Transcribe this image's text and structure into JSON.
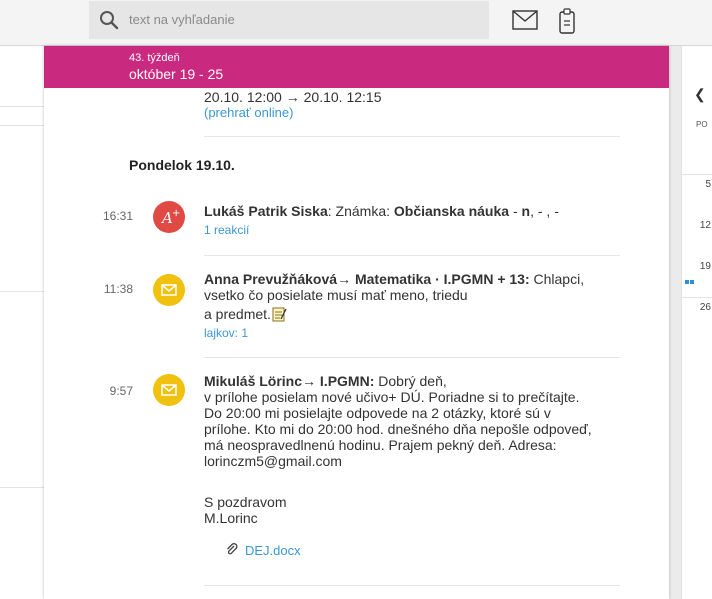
{
  "search": {
    "placeholder": "text na vyhľadanie"
  },
  "week": {
    "number_label": "43. týždeň",
    "range": "október 19 - 25"
  },
  "top_item": {
    "time_range": "20.10. 12:00 → 20.10. 12:15",
    "link": "(prehrať online)"
  },
  "day_heading": "Pondelok 19.10.",
  "items": [
    {
      "time": "16:31",
      "icon": "grade-plus-icon",
      "author": "Lukáš Patrik Siska",
      "sep": ": Známka: ",
      "subject": "Občianska náuka",
      "tail_pre": " - ",
      "grade": "n",
      "tail_post": ", - , -",
      "meta": "1 reakcií"
    },
    {
      "time": "11:38",
      "icon": "envelope-icon",
      "author": "Anna Prevužňáková",
      "arrow": "→ Matematika · I.PGMN + 13:",
      "line1": " Chlapci,",
      "line2": "vsetko čo posielate musí mať meno, triedu",
      "line3": "a predmet.",
      "meta": "lajkov: 1"
    },
    {
      "time": "9:57",
      "icon": "envelope-icon",
      "author": "Mikuláš Lörinc",
      "arrow": "→ I.PGMN:",
      "lines": [
        " Dobrý deň,",
        "v prílohe posielam nové učivo+ DÚ. Poriadne si to prečítajte.",
        "Do 20:00 mi posielajte odpovede na 2 otázky, ktoré sú v",
        "prílohe. Kto mi do 20:00 hod. dnešného dňa nepošle odpoveď,",
        "má neospravedlnenú hodinu. Prajem pekný deň. Adresa:",
        "lorinczm5@gmail.com"
      ],
      "signature": [
        "S pozdravom",
        "M.Lorinc"
      ],
      "attachment": "DEJ.docx"
    }
  ],
  "calendar": {
    "day_header": "PO",
    "days": [
      "5",
      "12",
      "19",
      "26"
    ]
  },
  "colors": {
    "week_bar": "#c9297f",
    "link": "#3b97d3",
    "grade_icon": "#e04a45",
    "message_icon": "#f1c10f"
  }
}
